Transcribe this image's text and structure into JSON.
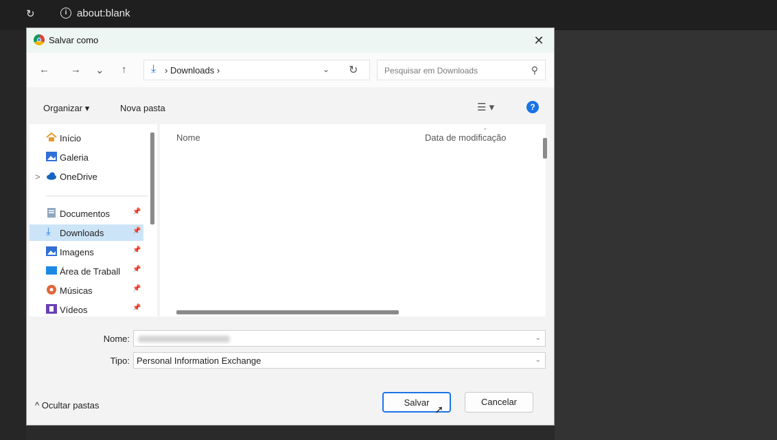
{
  "browser": {
    "url": "about:blank"
  },
  "dialog": {
    "title": "Salvar como",
    "close": "✕",
    "nav": {
      "back": "←",
      "forward": "→",
      "recent": "⌄",
      "up": "↑",
      "path_crumb": "› Downloads ›",
      "path_dropdown": "⌄",
      "refresh": "↻",
      "search_placeholder": "Pesquisar em Downloads"
    },
    "toolbar": {
      "organize": "Organizar ▾",
      "new_folder": "Nova pasta",
      "view": "☰ ▾",
      "help": "?"
    },
    "sidebar": {
      "items": [
        {
          "label": "Início"
        },
        {
          "label": "Galeria"
        },
        {
          "label": "OneDrive",
          "expander": ">"
        },
        {
          "label": "Documentos"
        },
        {
          "label": "Downloads"
        },
        {
          "label": "Imagens"
        },
        {
          "label": "Área de Traball"
        },
        {
          "label": "Músicas"
        },
        {
          "label": "Vídeos"
        }
      ]
    },
    "files": {
      "col_name": "Nome",
      "col_date": "Data de modificação",
      "sort_indicator": "⌄"
    },
    "fields": {
      "name_label": "Nome:",
      "type_label": "Tipo:",
      "type_value": "Personal Information Exchange"
    },
    "footer": {
      "hide_folders": "^ Ocultar pastas",
      "save": "Salvar",
      "cancel": "Cancelar"
    }
  },
  "colors": {
    "accent": "#1a73e8",
    "selection": "#cce4f7",
    "dialog_bg": "#f3f3f3",
    "titlebar_bg": "#eef6f4"
  }
}
